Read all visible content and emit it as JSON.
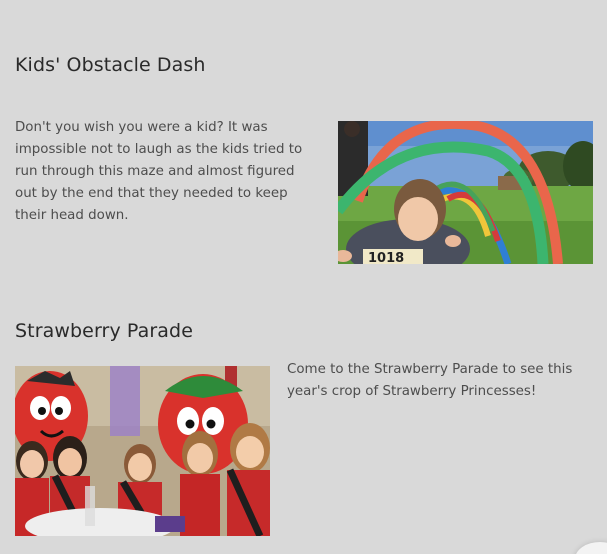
{
  "sections": [
    {
      "title": "Kids' Obstacle Dash",
      "text": "Don't you wish you were a kid? It was impossible not to laugh as the kids tried to run through this maze and almost figured out by the end that they needed to keep their head down.",
      "photo_number": "1018"
    },
    {
      "title": "Strawberry Parade",
      "text": "Come to the Strawberry Parade to see this year's crop of Strawberry Princesses!"
    }
  ],
  "colors": {
    "background": "#d9d9d9",
    "heading": "#2a2a2a",
    "body_text": "#4d4d4d"
  }
}
